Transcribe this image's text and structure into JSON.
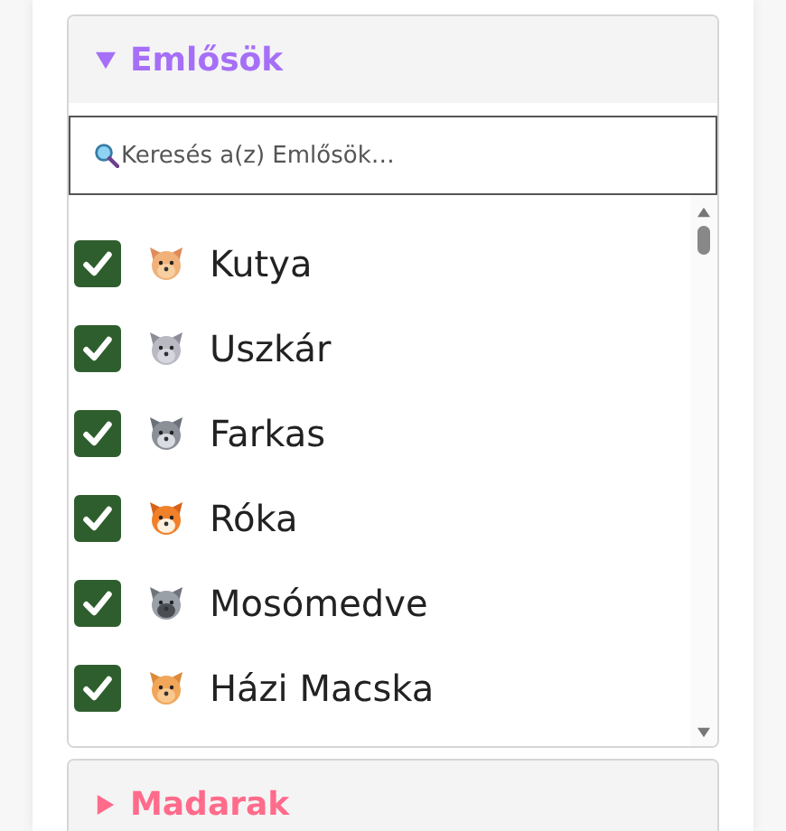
{
  "sections": [
    {
      "title": "Emlősök",
      "color": "#a66ff7",
      "expanded": true,
      "search": {
        "placeholder": "Keresés a(z) Emlősök…"
      },
      "items": [
        {
          "label": "Kutya",
          "kind": "dog",
          "checked": true
        },
        {
          "label": "Uszkár",
          "kind": "poodle",
          "checked": true
        },
        {
          "label": "Farkas",
          "kind": "wolf",
          "checked": true
        },
        {
          "label": "Róka",
          "kind": "fox",
          "checked": true
        },
        {
          "label": "Mosómedve",
          "kind": "raccoon",
          "checked": true
        },
        {
          "label": "Házi Macska",
          "kind": "cat",
          "checked": true
        }
      ]
    },
    {
      "title": "Madarak",
      "color": "#ff6b8b",
      "expanded": false
    }
  ]
}
